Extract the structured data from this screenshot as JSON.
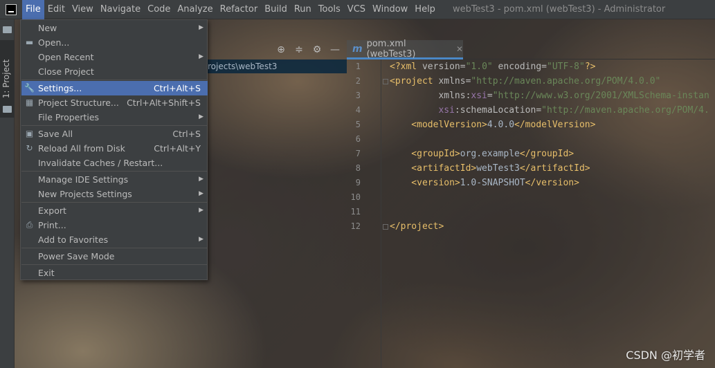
{
  "menubar": {
    "items": [
      "File",
      "Edit",
      "View",
      "Navigate",
      "Code",
      "Analyze",
      "Refactor",
      "Build",
      "Run",
      "Tools",
      "VCS",
      "Window",
      "Help"
    ],
    "title": "webTest3 - pom.xml (webTest3) - Administrator"
  },
  "left_strip": {
    "project_tab": "1: Project"
  },
  "project_panel": {
    "path_fragment": "rojects\\webTest3"
  },
  "editor": {
    "tab_label": "pom.xml (webTest3)",
    "tab_icon": "m",
    "line_numbers": [
      "1",
      "2",
      "3",
      "4",
      "5",
      "6",
      "7",
      "8",
      "9",
      "10",
      "11",
      "12"
    ],
    "lines": [
      [
        {
          "c": "tag",
          "t": "<?xml "
        },
        {
          "c": "attr",
          "t": "version="
        },
        {
          "c": "val",
          "t": "\"1.0\""
        },
        {
          "c": "attr",
          "t": " encoding="
        },
        {
          "c": "val",
          "t": "\"UTF-8\""
        },
        {
          "c": "tag",
          "t": "?>"
        }
      ],
      [
        {
          "c": "tag",
          "t": "<project "
        },
        {
          "c": "attr",
          "t": "xmlns="
        },
        {
          "c": "val",
          "t": "\"http://maven.apache.org/POM/4.0.0\""
        }
      ],
      [
        {
          "c": "attr",
          "t": "         xmlns:"
        },
        {
          "c": "ns",
          "t": "xsi"
        },
        {
          "c": "attr",
          "t": "="
        },
        {
          "c": "val",
          "t": "\"http://www.w3.org/2001/XMLSchema-instan"
        }
      ],
      [
        {
          "c": "ns",
          "t": "         xsi"
        },
        {
          "c": "attr",
          "t": ":schemaLocation="
        },
        {
          "c": "val",
          "t": "\"http://maven.apache.org/POM/4."
        }
      ],
      [
        {
          "c": "tag",
          "t": "    <modelVersion>"
        },
        {
          "c": "txt",
          "t": "4.0.0"
        },
        {
          "c": "tag",
          "t": "</modelVersion>"
        }
      ],
      [],
      [
        {
          "c": "tag",
          "t": "    <groupId>"
        },
        {
          "c": "txt",
          "t": "org.example"
        },
        {
          "c": "tag",
          "t": "</groupId>"
        }
      ],
      [
        {
          "c": "tag",
          "t": "    <artifactId>"
        },
        {
          "c": "txt",
          "t": "webTest3"
        },
        {
          "c": "tag",
          "t": "</artifactId>"
        }
      ],
      [
        {
          "c": "tag",
          "t": "    <version>"
        },
        {
          "c": "txt",
          "t": "1.0-SNAPSHOT"
        },
        {
          "c": "tag",
          "t": "</version>"
        }
      ],
      [],
      [],
      [
        {
          "c": "tag",
          "t": "</project>"
        }
      ]
    ]
  },
  "file_menu": {
    "items": [
      {
        "label": "New",
        "shortcut": "",
        "submenu": true,
        "icon": ""
      },
      {
        "label": "Open...",
        "shortcut": "",
        "submenu": false,
        "icon": "folder-icon"
      },
      {
        "label": "Open Recent",
        "shortcut": "",
        "submenu": true,
        "icon": ""
      },
      {
        "label": "Close Project",
        "shortcut": "",
        "submenu": false,
        "icon": ""
      },
      {
        "label": "Settings...",
        "shortcut": "Ctrl+Alt+S",
        "submenu": false,
        "icon": "wrench-icon",
        "selected": true
      },
      {
        "label": "Project Structure...",
        "shortcut": "Ctrl+Alt+Shift+S",
        "submenu": false,
        "icon": "project-structure-icon"
      },
      {
        "label": "File Properties",
        "shortcut": "",
        "submenu": true,
        "icon": ""
      },
      {
        "label": "Save All",
        "shortcut": "Ctrl+S",
        "submenu": false,
        "icon": "save-icon"
      },
      {
        "label": "Reload All from Disk",
        "shortcut": "Ctrl+Alt+Y",
        "submenu": false,
        "icon": "reload-icon"
      },
      {
        "label": "Invalidate Caches / Restart...",
        "shortcut": "",
        "submenu": false,
        "icon": ""
      },
      {
        "label": "Manage IDE Settings",
        "shortcut": "",
        "submenu": true,
        "icon": ""
      },
      {
        "label": "New Projects Settings",
        "shortcut": "",
        "submenu": true,
        "icon": ""
      },
      {
        "label": "Export",
        "shortcut": "",
        "submenu": true,
        "icon": ""
      },
      {
        "label": "Print...",
        "shortcut": "",
        "submenu": false,
        "icon": "print-icon"
      },
      {
        "label": "Add to Favorites",
        "shortcut": "",
        "submenu": true,
        "icon": ""
      },
      {
        "label": "Power Save Mode",
        "shortcut": "",
        "submenu": false,
        "icon": ""
      },
      {
        "label": "Exit",
        "shortcut": "",
        "submenu": false,
        "icon": ""
      }
    ]
  },
  "watermark": "CSDN @初学者",
  "colors": {
    "menu_bg": "#3c3f41",
    "selection": "#4b6eaf",
    "xml_tag": "#e8bf6a",
    "xml_value": "#6a8759",
    "xml_namespace": "#9876aa"
  }
}
